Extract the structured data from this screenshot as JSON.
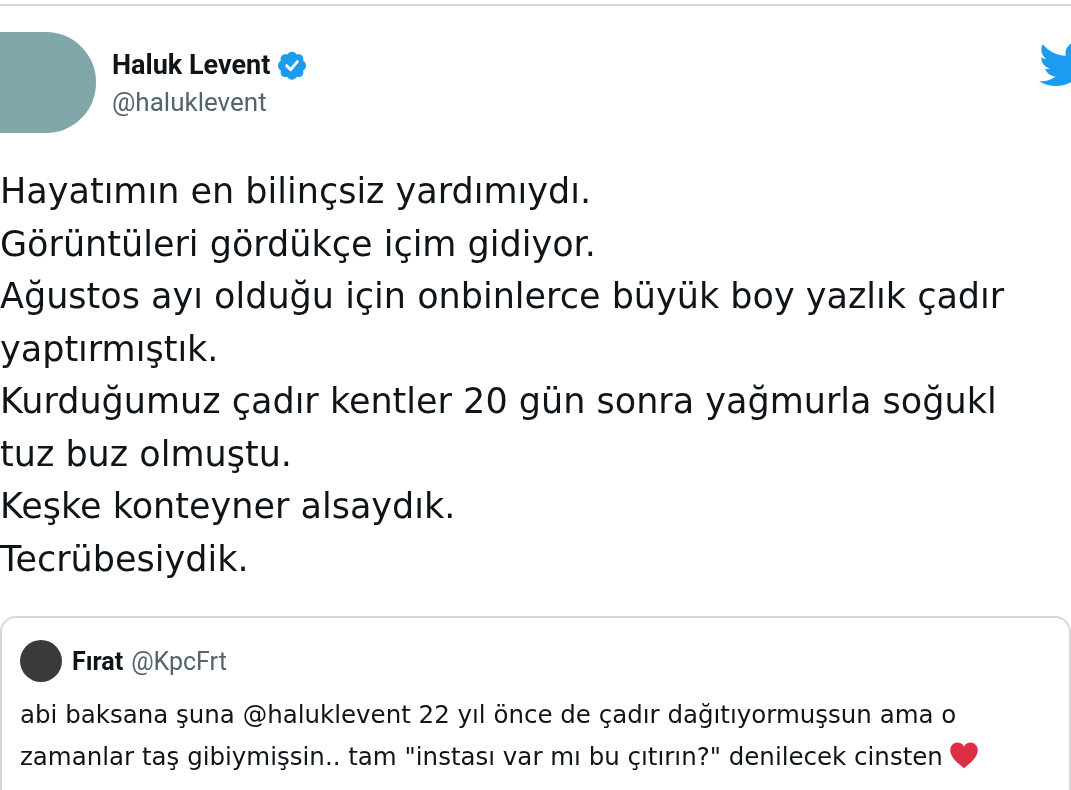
{
  "tweet": {
    "author": {
      "name": "Haluk Levent",
      "handle": "@haluklevent",
      "verified": true
    },
    "lines": [
      "Hayatımın en bilinçsiz yardımıydı.",
      "Görüntüleri gördükçe içim gidiyor.",
      "Ağustos ayı olduğu için onbinlerce büyük boy yazlık çadır",
      "yaptırmıştık.",
      "Kurduğumuz çadır kentler 20 gün sonra yağmurla soğukl",
      "tuz buz olmuştu.",
      "Keşke konteyner alsaydık.",
      "Tecrübesiydik."
    ],
    "quoted": {
      "name": "Fırat",
      "handle": "@KpcFrt",
      "text": "abi baksana şuna @haluklevent 22 yıl önce de çadır dağıtıyormuşsun ama o zamanlar taş gibiymişsin.. tam \"instası var mı bu çıtırın?\" denilecek cinsten"
    }
  }
}
